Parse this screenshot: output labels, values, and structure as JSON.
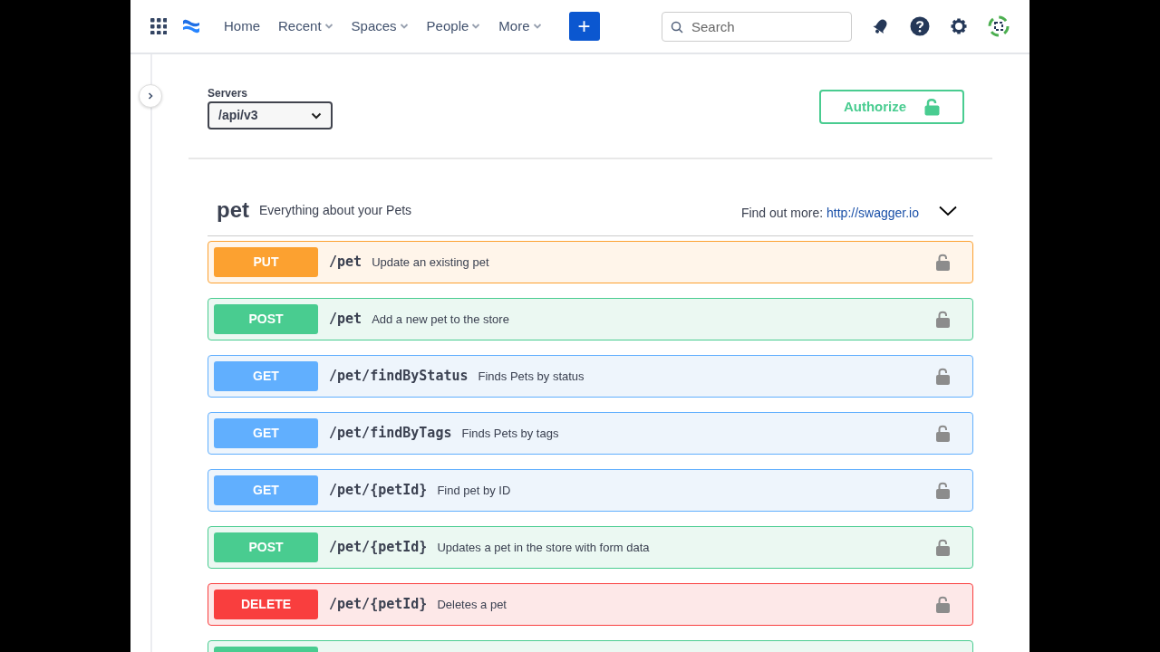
{
  "nav": {
    "items": [
      {
        "label": "Home",
        "dropdown": false
      },
      {
        "label": "Recent",
        "dropdown": true
      },
      {
        "label": "Spaces",
        "dropdown": true
      },
      {
        "label": "People",
        "dropdown": true
      },
      {
        "label": "More",
        "dropdown": true
      }
    ],
    "create_button": "+",
    "search": {
      "placeholder": "Search"
    }
  },
  "servers": {
    "label": "Servers",
    "value": "/api/v3"
  },
  "authorize_button": "Authorize",
  "tag": {
    "name": "pet",
    "description": "Everything about your Pets",
    "more_label": "Find out more:",
    "more_link": "http://swagger.io",
    "expanded": true
  },
  "operations": [
    {
      "kind": "put",
      "label": "PUT",
      "path": "/pet",
      "summary": "Update an existing pet"
    },
    {
      "kind": "post",
      "label": "POST",
      "path": "/pet",
      "summary": "Add a new pet to the store"
    },
    {
      "kind": "get",
      "label": "GET",
      "path": "/pet/findByStatus",
      "summary": "Finds Pets by status"
    },
    {
      "kind": "get",
      "label": "GET",
      "path": "/pet/findByTags",
      "summary": "Finds Pets by tags"
    },
    {
      "kind": "get",
      "label": "GET",
      "path": "/pet/{petId}",
      "summary": "Find pet by ID"
    },
    {
      "kind": "post",
      "label": "POST",
      "path": "/pet/{petId}",
      "summary": "Updates a pet in the store with form data"
    },
    {
      "kind": "delete",
      "label": "DELETE",
      "path": "/pet/{petId}",
      "summary": "Deletes a pet"
    },
    {
      "kind": "post"
    }
  ]
}
